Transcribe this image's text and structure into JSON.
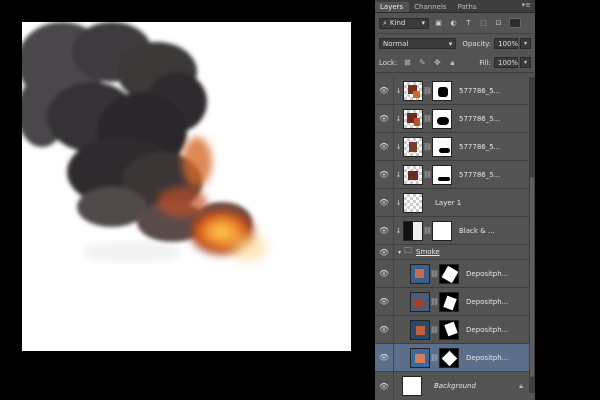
{
  "tabs": [
    "Layers",
    "Channels",
    "Paths"
  ],
  "filter": {
    "kind": "Kind"
  },
  "blend": {
    "mode": "Normal",
    "opacity_label": "Opacity:",
    "opacity": "100%"
  },
  "lock": {
    "label": "Lock:",
    "fill_label": "Fill:",
    "fill": "100%"
  },
  "layers": [
    {
      "name": "577786_5..."
    },
    {
      "name": "577786_5..."
    },
    {
      "name": "577786_5..."
    },
    {
      "name": "577786_5..."
    },
    {
      "name": "Layer 1"
    },
    {
      "name": "Black & ..."
    }
  ],
  "group": {
    "name": "Smoke"
  },
  "group_layers": [
    {
      "name": "Depositph..."
    },
    {
      "name": "Depositph..."
    },
    {
      "name": "Depositph..."
    },
    {
      "name": "Depositph..."
    }
  ],
  "background": {
    "name": "Background"
  }
}
